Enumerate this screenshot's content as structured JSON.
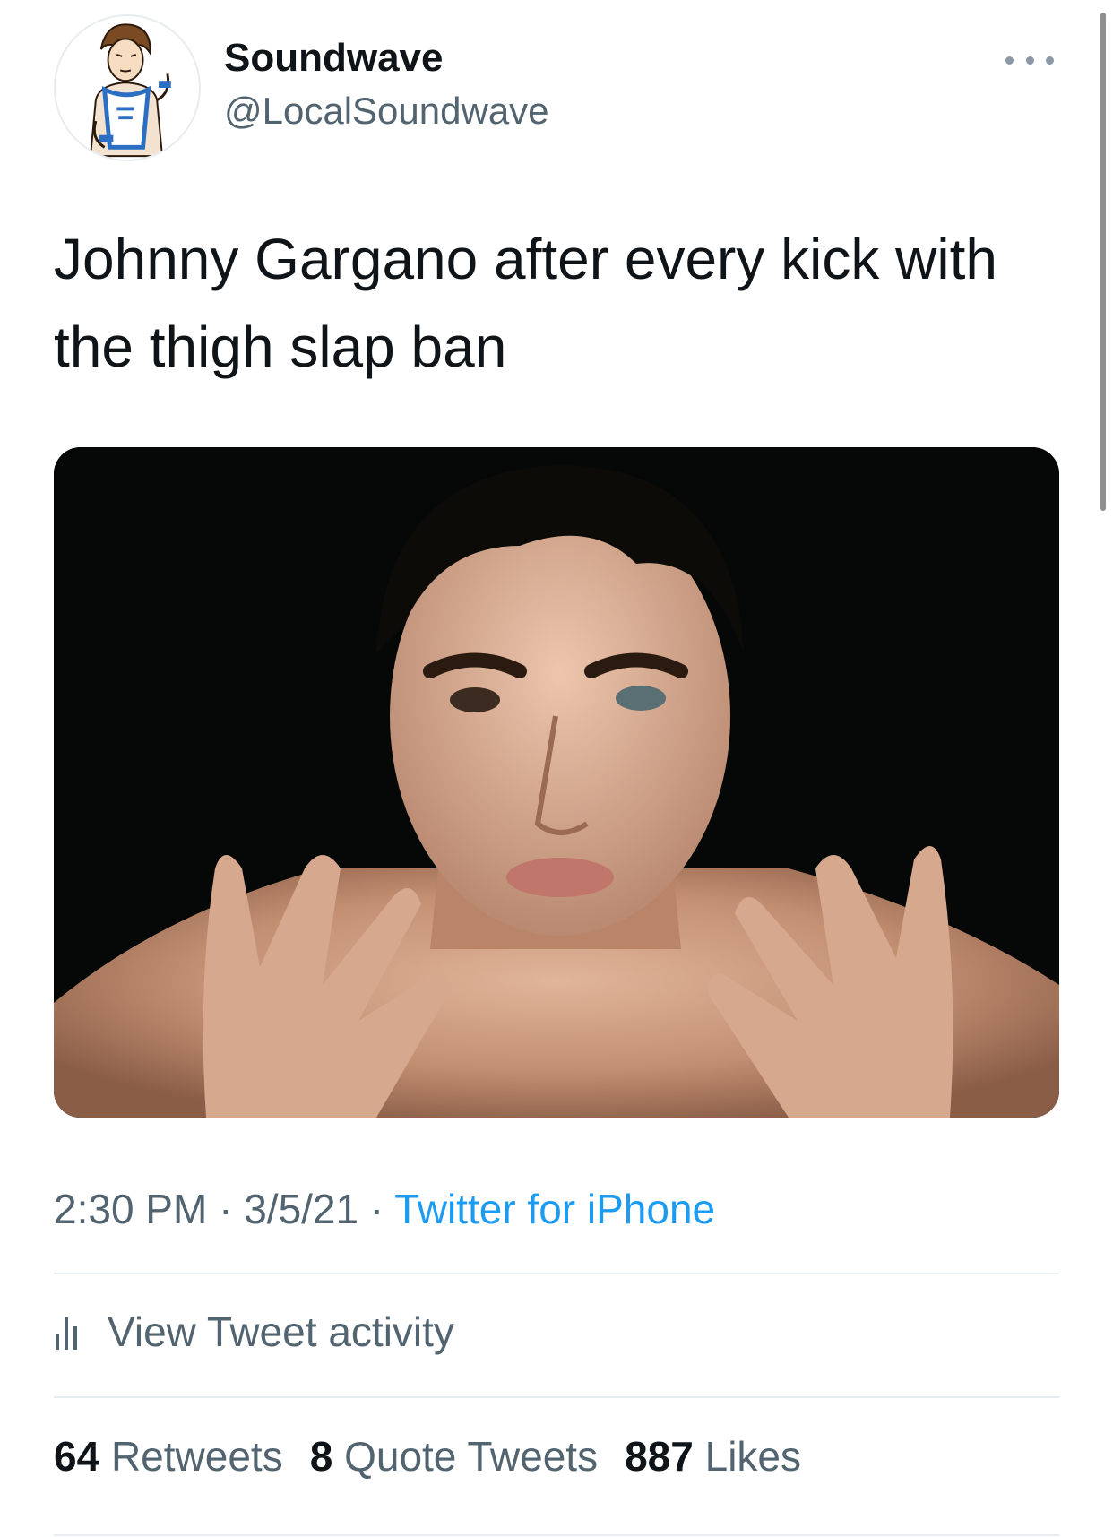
{
  "author": {
    "display_name": "Soundwave",
    "handle": "@LocalSoundwave",
    "avatar_icon": "cartoon-wrestler-avatar"
  },
  "tweet": {
    "text": "Johnny Gargano after every kick with the thigh slap ban",
    "image_icon": "shirtless-man-reaching-hands-photo"
  },
  "meta": {
    "time": "2:30 PM",
    "separator": "·",
    "date": "3/5/21",
    "source": "Twitter for iPhone"
  },
  "activity": {
    "label": "View Tweet activity",
    "icon": "bar-chart-icon"
  },
  "stats": {
    "retweets_count": "64",
    "retweets_label": "Retweets",
    "quotes_count": "8",
    "quotes_label": "Quote Tweets",
    "likes_count": "887",
    "likes_label": "Likes"
  },
  "colors": {
    "text_primary": "#0f1419",
    "text_secondary": "#536471",
    "link": "#1d9bf0",
    "divider": "#e6ecf0"
  }
}
